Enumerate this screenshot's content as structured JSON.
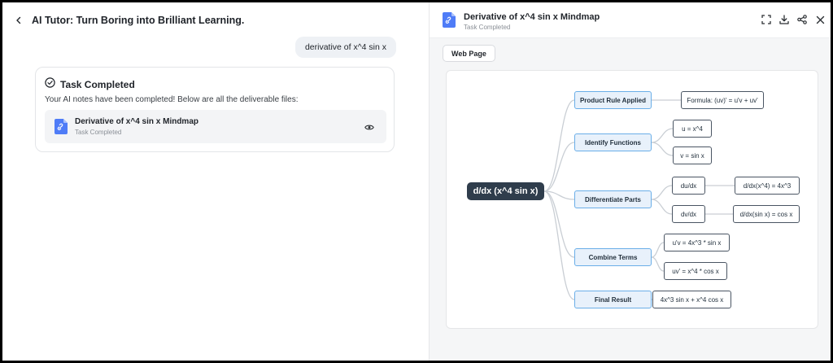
{
  "app": {
    "title": "AI Tutor: Turn Boring into Brilliant Learning."
  },
  "chat": {
    "user_message": "derivative of x^4 sin x",
    "task_card": {
      "title": "Task Completed",
      "text": "Your AI notes have been completed! Below are all the deliverable files:",
      "file": {
        "name": "Derivative of x^4 sin x Mindmap",
        "status": "Task Completed"
      }
    }
  },
  "preview": {
    "title": "Derivative of x^4 sin x Mindmap",
    "status": "Task Completed",
    "tab_label": "Web Page",
    "toolbar_icons": [
      "fullscreen-icon",
      "download-icon",
      "share-icon",
      "close-icon"
    ]
  },
  "mindmap": {
    "root": "d/dx (x^4 sin x)",
    "branches": [
      {
        "label": "Product Rule Applied",
        "children": [
          {
            "label": "Formula: (uv)' = u'v + uv'",
            "children": []
          }
        ]
      },
      {
        "label": "Identify Functions",
        "children": [
          {
            "label": "u = x^4",
            "children": []
          },
          {
            "label": "v = sin x",
            "children": []
          }
        ]
      },
      {
        "label": "Differentiate Parts",
        "children": [
          {
            "label": "du/dx",
            "children": [
              {
                "label": "d/dx(x^4) = 4x^3"
              }
            ]
          },
          {
            "label": "dv/dx",
            "children": [
              {
                "label": "d/dx(sin x) = cos x"
              }
            ]
          }
        ]
      },
      {
        "label": "Combine Terms",
        "children": [
          {
            "label": "u'v = 4x^3 * sin x",
            "children": []
          },
          {
            "label": "uv' = x^4 * cos x",
            "children": []
          }
        ]
      },
      {
        "label": "Final Result",
        "children": [
          {
            "label": "4x^3 sin x + x^4 cos x",
            "children": []
          }
        ]
      }
    ]
  },
  "colors": {
    "accent": "#4f7cf7",
    "root_fill": "#2f3d4c",
    "branch_fill": "#e8f1fb",
    "branch_border": "#6aaee8",
    "edge": "#c9ced4"
  }
}
